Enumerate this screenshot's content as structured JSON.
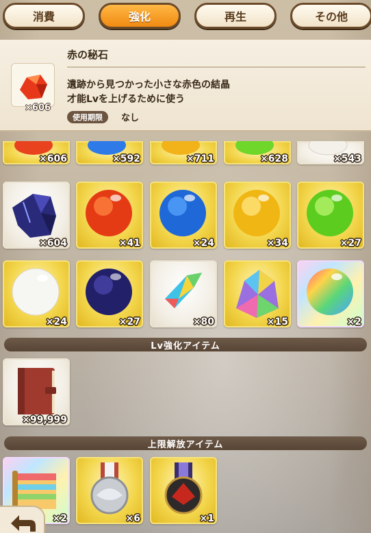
{
  "tabs": [
    {
      "label": "消費"
    },
    {
      "label": "強化"
    },
    {
      "label": "再生"
    },
    {
      "label": "その他"
    }
  ],
  "detail": {
    "name": "赤の秘石",
    "count": "×606",
    "desc_line1": "遺跡から見つかった小さな赤色の結晶",
    "desc_line2": "才能Lvを上げるために使う",
    "expiry_label": "使用期限",
    "expiry_value": "なし"
  },
  "grid_row0": [
    {
      "count": "×606",
      "icon": "red-stone-icon"
    },
    {
      "count": "×592",
      "icon": "blue-stone-icon"
    },
    {
      "count": "×711",
      "icon": "yellow-stone-icon"
    },
    {
      "count": "×628",
      "icon": "green-stone-icon"
    },
    {
      "count": "×543",
      "icon": "white-stone-icon"
    }
  ],
  "grid_row1": [
    {
      "count": "×604",
      "icon": "dark-crystal-icon"
    },
    {
      "count": "×41",
      "icon": "red-orb-icon"
    },
    {
      "count": "×24",
      "icon": "blue-orb-icon"
    },
    {
      "count": "×34",
      "icon": "yellow-orb-icon"
    },
    {
      "count": "×27",
      "icon": "green-orb-icon"
    }
  ],
  "grid_row2": [
    {
      "count": "×24",
      "icon": "white-orb-icon"
    },
    {
      "count": "×27",
      "icon": "dark-orb-icon"
    },
    {
      "count": "×80",
      "icon": "rainbow-shard-icon"
    },
    {
      "count": "×15",
      "icon": "rainbow-crystal-icon"
    },
    {
      "count": "×2",
      "icon": "rainbow-orb-icon"
    }
  ],
  "section_lv": "Lv強化アイテム",
  "lv_items": [
    {
      "count": "×99,999",
      "icon": "book-icon"
    }
  ],
  "section_limit": "上限解放アイテム",
  "limit_items": [
    {
      "count": "×2",
      "icon": "rainbow-scroll-icon"
    },
    {
      "count": "×6",
      "icon": "silver-medal-icon"
    },
    {
      "count": "×1",
      "icon": "red-medal-icon"
    }
  ],
  "colors": {
    "tab_active": "#f08a12",
    "tab_border": "#6b4a2a",
    "cell_gold": "#f3d64c",
    "section_bar": "#574434"
  }
}
